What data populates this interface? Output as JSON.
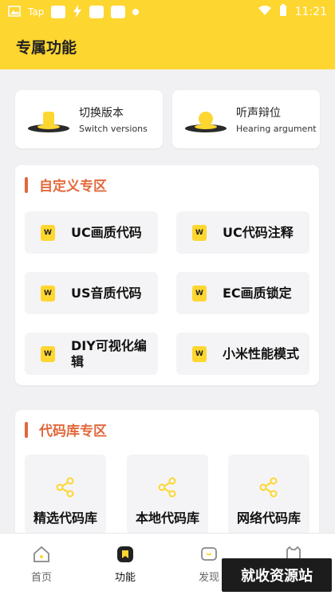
{
  "status_bar": {
    "carrier_text": "Tap",
    "time": "11:21"
  },
  "header": {
    "title": "专属功能"
  },
  "top_cards": [
    {
      "title": "切换版本",
      "subtitle": "Switch versions"
    },
    {
      "title": "听声辩位",
      "subtitle": "Hearing argument"
    }
  ],
  "custom_section": {
    "title": "自定义专区",
    "icon_glyph": "W",
    "items": [
      {
        "label": "UC画质代码"
      },
      {
        "label": "UC代码注释"
      },
      {
        "label": "US音质代码"
      },
      {
        "label": "EC画质锁定"
      },
      {
        "label": "DIY可视化编辑"
      },
      {
        "label": "小米性能模式"
      }
    ]
  },
  "library_section": {
    "title": "代码库专区",
    "items": [
      {
        "label": "精选代码库"
      },
      {
        "label": "本地代码库"
      },
      {
        "label": "网络代码库"
      }
    ]
  },
  "tab_bar": {
    "tabs": [
      {
        "label": "首页"
      },
      {
        "label": "功能"
      },
      {
        "label": "发现"
      }
    ]
  },
  "watermark": {
    "text": "就收资源站"
  },
  "colors": {
    "brand_yellow": "#fed630",
    "accent_orange": "#e3683b",
    "background": "#f1f1f3"
  }
}
